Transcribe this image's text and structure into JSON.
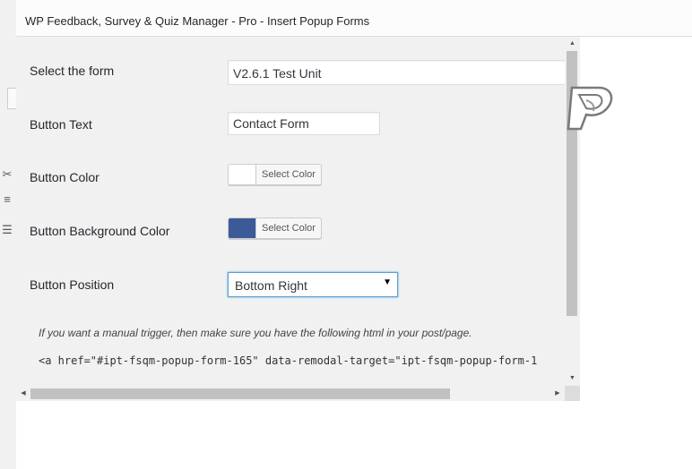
{
  "modal": {
    "title": "WP Feedback, Survey & Quiz Manager - Pro - Insert Popup Forms"
  },
  "form": {
    "select_form": {
      "label": "Select the form",
      "value": "V2.6.1 Test Unit"
    },
    "button_text": {
      "label": "Button Text",
      "value": "Contact Form"
    },
    "button_color": {
      "label": "Button Color",
      "swatch": "#ffffff",
      "picker_label": "Select Color"
    },
    "button_bg_color": {
      "label": "Button Background Color",
      "swatch": "#3c5a9a",
      "picker_label": "Select Color"
    },
    "button_position": {
      "label": "Button Position",
      "value": "Bottom Right"
    }
  },
  "help": {
    "manual_trigger": "If you want a manual trigger, then make sure you have the following html in your post/page.",
    "code": "<a href=\"#ipt-fsqm-popup-form-165\" data-remodal-target=\"ipt-fsqm-popup-form-1"
  },
  "icons": {
    "logo": "fsqm-logo",
    "select_arrow": "▼"
  }
}
